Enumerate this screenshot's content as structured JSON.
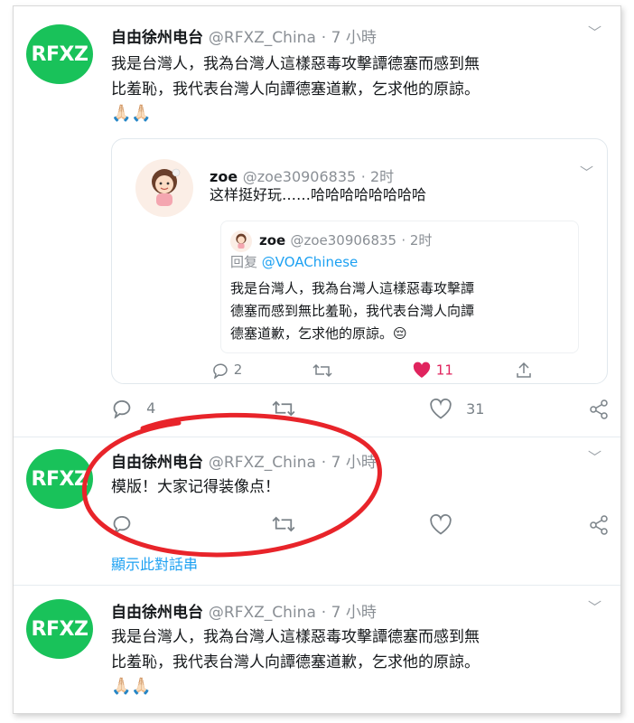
{
  "tweets": [
    {
      "avatar": "RFXZ",
      "name": "自由徐州电台",
      "handle": "@RFXZ_China",
      "time": "· 7 小時",
      "lines": [
        "我是台灣人，我為台灣人這樣惡毒攻擊譚德塞而感到無",
        "比羞恥，我代表台灣人向譚德塞道歉，乞求他的原諒。"
      ],
      "emoji": "🙏🏻🙏🏻",
      "quote": {
        "name": "zoe",
        "handle": "@zoe30906835",
        "time": "· 2时",
        "text": "这样挺好玩……哈哈哈哈哈哈哈哈",
        "inner": {
          "name": "zoe",
          "handle": "@zoe30906835",
          "time": "· 2时",
          "reply_label": "回复",
          "reply_handle": "@VOAChinese",
          "lines": [
            "我是台灣人，我為台灣人這樣惡毒攻擊譚",
            "德塞而感到無比羞恥，我代表台灣人向譚",
            "德塞道歉，乞求他的原諒。😔"
          ]
        },
        "actions": {
          "replies": "2",
          "likes": "11"
        }
      },
      "actions": {
        "replies": "4",
        "likes": "31"
      }
    },
    {
      "avatar": "RFXZ",
      "name": "自由徐州电台",
      "handle": "@RFXZ_China",
      "time": "· 7 小時",
      "text": "模版！大家记得装像点！",
      "show_thread": "顯示此對話串"
    },
    {
      "avatar": "RFXZ",
      "name": "自由徐州电台",
      "handle": "@RFXZ_China",
      "time": "· 7 小時",
      "lines": [
        "我是台灣人，我為台灣人這樣惡毒攻擊譚德塞而感到無",
        "比羞恥，我代表台灣人向譚德塞道歉，乞求他的原諒。"
      ],
      "emoji": "🙏🏻🙏🏻"
    }
  ],
  "colors": {
    "avatar": "#19c25a",
    "accent": "#1da1f2",
    "like": "#e0245e",
    "annotation": "#e8242a"
  },
  "icons": [
    "chevron-down-icon",
    "reply-icon",
    "retweet-icon",
    "like-icon",
    "share-icon"
  ]
}
